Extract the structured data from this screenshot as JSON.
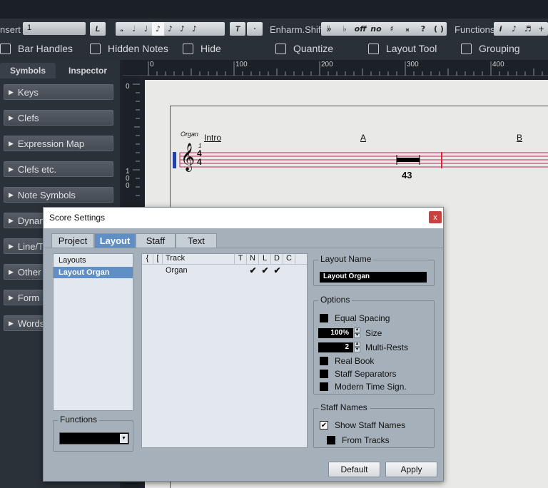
{
  "toolbar": {
    "insert_label": "nsert",
    "insert_value": "1",
    "insert_btn": "L",
    "note_values": [
      "𝅝",
      "𝅗𝅥",
      "♩",
      "♪",
      "♪",
      "♪",
      "♪"
    ],
    "tuplet_label": "T",
    "dot_label": "·",
    "enharm_label": "Enharm.Shift",
    "enharm_values": [
      "𝄫",
      "♭",
      "off",
      "no",
      "♯",
      "𝄪",
      "?",
      "( )"
    ],
    "functions_label": "Functions",
    "function_values": [
      "i",
      "♪",
      "♬",
      "+"
    ]
  },
  "view_options": [
    {
      "label": "Bar Handles"
    },
    {
      "label": "Hidden Notes"
    },
    {
      "label": "Hide"
    },
    {
      "label": "Quantize"
    },
    {
      "label": "Layout Tool"
    },
    {
      "label": "Grouping"
    }
  ],
  "left_panel": {
    "tabs": [
      "Symbols",
      "Inspector"
    ],
    "items": [
      "Keys",
      "Clefs",
      "Expression Map",
      "Clefs etc.",
      "Note Symbols",
      "Dynamics",
      "Line/Trill",
      "Other",
      "Form Symbols",
      "Words"
    ]
  },
  "ruler": {
    "top_marks": [
      "0",
      "100",
      "200",
      "300",
      "400"
    ],
    "left_marks": [
      "0",
      "100"
    ]
  },
  "score": {
    "staff_name": "Organ",
    "marker_intro": "Intro",
    "marker_a": "A",
    "marker_b": "B",
    "bar_number": "1",
    "time_sig_top": "4",
    "time_sig_bottom": "4",
    "multirest_count": "43"
  },
  "dialog": {
    "title": "Score Settings",
    "close": "x",
    "tabs": [
      "Project",
      "Layout",
      "Staff",
      "Text"
    ],
    "active_tab": "Layout",
    "layouts_header": "Layouts",
    "layouts": [
      "Layout Organ"
    ],
    "functions_legend": "Functions",
    "functions_value": "",
    "track_headers": [
      "{",
      "[",
      "Track",
      "T",
      "N",
      "L",
      "D",
      "C"
    ],
    "tracks": [
      {
        "name": "Organ",
        "N": "✔",
        "L": "✔",
        "D": "✔"
      }
    ],
    "layout_name_legend": "Layout Name",
    "layout_name_value": "Layout Organ",
    "options_legend": "Options",
    "options": {
      "equal_spacing": "Equal Spacing",
      "size_value": "100%",
      "size_label": "Size",
      "multirests_value": "2",
      "multirests_label": "Multi-Rests",
      "real_book": "Real Book",
      "staff_separators": "Staff Separators",
      "modern_time": "Modern Time Sign."
    },
    "staff_names_legend": "Staff Names",
    "show_staff_names": "Show Staff Names",
    "show_staff_names_checked": "✔",
    "from_tracks": "From Tracks",
    "default_btn": "Default",
    "apply_btn": "Apply"
  }
}
